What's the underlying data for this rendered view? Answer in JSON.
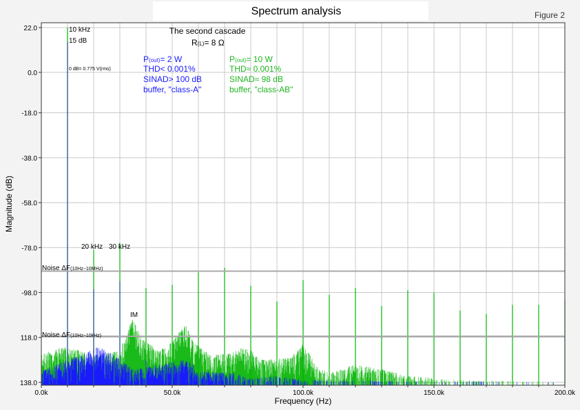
{
  "chart_data": {
    "type": "bar",
    "title": "Spectrum analysis",
    "figure_label": "Figure 2",
    "xlabel": "Frequency (Hz)",
    "ylabel": "Magnitude (dB)",
    "xlim_khz": [
      0,
      200
    ],
    "ylim": [
      -138,
      22
    ],
    "x_ticks": [
      {
        "value": 0,
        "label": "0.0k"
      },
      {
        "value": 50,
        "label": "50.0k"
      },
      {
        "value": 100,
        "label": "100.0k"
      },
      {
        "value": 150,
        "label": "150.0k"
      },
      {
        "value": 200,
        "label": "200.0k"
      }
    ],
    "y_ticks": [
      {
        "value": 22,
        "label": "22.0"
      },
      {
        "value": 0,
        "label": "0.0"
      },
      {
        "value": -18,
        "label": "-18.0"
      },
      {
        "value": -38,
        "label": "-38.0"
      },
      {
        "value": -58,
        "label": "-58.0"
      },
      {
        "value": -78,
        "label": "-78.0"
      },
      {
        "value": -98,
        "label": "-98.0"
      },
      {
        "value": -118,
        "label": "118.0"
      },
      {
        "value": -138,
        "label": "138.0"
      }
    ],
    "grid": true,
    "annotations": {
      "subtitle": "The second cascade",
      "load_prefix": "R",
      "load_sub": "(L)",
      "load_value": "= 8 Ω",
      "fund_freq": "10 kHz",
      "fund_level": "15 dB",
      "reference": "0 dB= 0.775 V(rms)",
      "h2": "20 kHz",
      "h3": "30 kHz",
      "im": "IM",
      "noise_wide_prefix": "Noise ΔF",
      "noise_wide_sub": "(10Hz~10MHz)",
      "noise_narrow_prefix": "Noise ΔF",
      "noise_narrow_sub": "(10Hz~10kHz)"
    },
    "noise_levels": {
      "wide": -88.5,
      "narrow": -117.5
    },
    "series": [
      {
        "name": "class-A",
        "color": "#1a1aff",
        "legend": {
          "p_prefix": "P",
          "p_sub": "(out)",
          "p_value": "= 2 W",
          "thd": "THD< 0.001%",
          "sinad": "SINAD> 100 dB",
          "desc": "buffer, \"class-A\""
        },
        "peaks": [
          [
            10,
            15
          ],
          [
            20,
            -96.5
          ],
          [
            30,
            -93
          ],
          [
            40,
            -128
          ],
          [
            60,
            -135
          ]
        ],
        "noise_envelope": [
          [
            0,
            -133
          ],
          [
            10,
            -128
          ],
          [
            15,
            -126
          ],
          [
            22,
            -122
          ],
          [
            28,
            -126
          ],
          [
            35,
            -132
          ],
          [
            45,
            -130
          ],
          [
            55,
            -128
          ],
          [
            62,
            -133
          ],
          [
            75,
            -134
          ],
          [
            80,
            -136
          ],
          [
            90,
            -135
          ],
          [
            100,
            -137
          ],
          [
            200,
            -138
          ]
        ]
      },
      {
        "name": "class-AB",
        "color": "#00b300",
        "legend": {
          "p_prefix": "P",
          "p_sub": "(out)",
          "p_value": "= 10 W",
          "thd": "THD≈ 0.001%",
          "sinad": "SINAD≈ 98 dB",
          "desc": "buffer, \"class-AB\""
        },
        "peaks": [
          [
            10,
            22
          ],
          [
            20,
            -79
          ],
          [
            30,
            -76
          ],
          [
            40,
            -96
          ],
          [
            50,
            -94.5
          ],
          [
            60,
            -89
          ],
          [
            70,
            -87
          ],
          [
            80,
            -95
          ],
          [
            90,
            -102
          ],
          [
            100,
            -92.5
          ],
          [
            110,
            -99
          ],
          [
            120,
            -96
          ],
          [
            130,
            -104
          ],
          [
            140,
            -97
          ],
          [
            150,
            -98
          ],
          [
            160,
            -106
          ],
          [
            170,
            -107.5
          ],
          [
            180,
            -103.5
          ],
          [
            190,
            -103.5
          ],
          [
            200,
            -101
          ]
        ],
        "noise_envelope": [
          [
            0,
            -125
          ],
          [
            10,
            -122
          ],
          [
            20,
            -126
          ],
          [
            30,
            -124
          ],
          [
            35,
            -109
          ],
          [
            38,
            -118
          ],
          [
            45,
            -124
          ],
          [
            50,
            -120
          ],
          [
            55,
            -112
          ],
          [
            58,
            -120
          ],
          [
            65,
            -126
          ],
          [
            72,
            -125
          ],
          [
            78,
            -122
          ],
          [
            85,
            -128
          ],
          [
            95,
            -127
          ],
          [
            100,
            -121
          ],
          [
            105,
            -130
          ],
          [
            110,
            -134
          ],
          [
            120,
            -130
          ],
          [
            130,
            -132
          ],
          [
            140,
            -135
          ],
          [
            160,
            -137
          ],
          [
            200,
            -138
          ]
        ]
      }
    ]
  }
}
